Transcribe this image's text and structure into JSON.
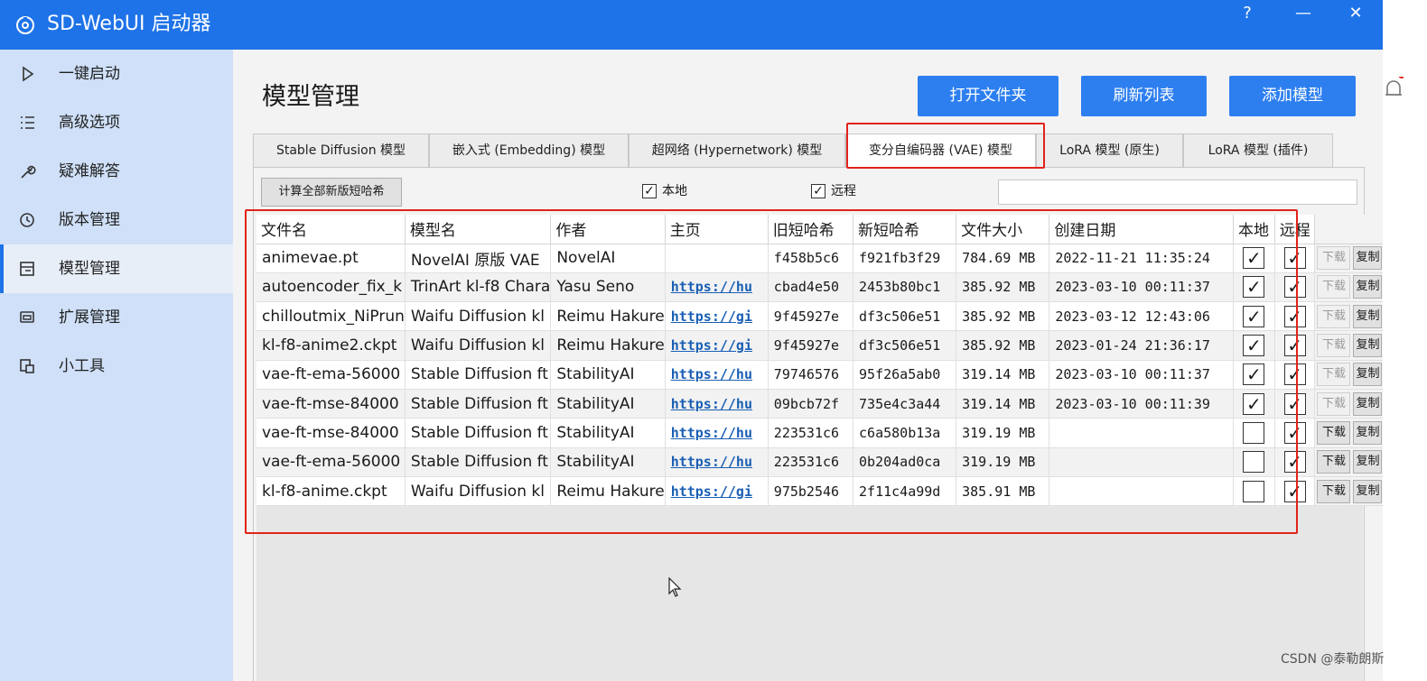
{
  "app": {
    "title": "SD-WebUI 启动器",
    "help_label": "?",
    "minimize_label": "—",
    "close_label": "✕"
  },
  "sidebar": {
    "items": [
      {
        "label": "一键启动",
        "icon": "play-icon"
      },
      {
        "label": "高级选项",
        "icon": "list-icon"
      },
      {
        "label": "疑难解答",
        "icon": "wrench-icon"
      },
      {
        "label": "版本管理",
        "icon": "history-icon"
      },
      {
        "label": "模型管理",
        "icon": "model-icon",
        "active": true
      },
      {
        "label": "扩展管理",
        "icon": "extension-icon"
      },
      {
        "label": "小工具",
        "icon": "tools-icon"
      }
    ]
  },
  "page": {
    "title": "模型管理",
    "buttons": {
      "open_folder": "打开文件夹",
      "refresh": "刷新列表",
      "add_model": "添加模型"
    },
    "tabs": [
      "Stable Diffusion 模型",
      "嵌入式 (Embedding) 模型",
      "超网络 (Hypernetwork) 模型",
      "变分自编码器 (VAE) 模型",
      "LoRA 模型 (原生)",
      "LoRA 模型 (插件)"
    ],
    "active_tab": 3,
    "calc_button": "计算全部新版短哈希",
    "filter_local": {
      "label": "本地",
      "checked": true
    },
    "filter_remote": {
      "label": "远程",
      "checked": true
    },
    "search_value": ""
  },
  "table": {
    "headers": [
      "文件名",
      "模型名",
      "作者",
      "主页",
      "旧短哈希",
      "新短哈希",
      "文件大小",
      "创建日期",
      "本地",
      "远程"
    ],
    "download_label": "下载",
    "copy_label": "复制",
    "check_mark": "✓",
    "rows": [
      {
        "file": "animevae.pt",
        "model": "NovelAI 原版 VAE",
        "author": "NovelAI",
        "home": "",
        "old_hash": "f458b5c6",
        "new_hash": "f921fb3f29",
        "size": "784.69 MB",
        "date": "2022-11-21 11:35:24",
        "local": true,
        "remote": true
      },
      {
        "file": "autoencoder_fix_k",
        "model": "TrinArt kl-f8 Chara",
        "author": "Yasu Seno",
        "home": "https://hu",
        "old_hash": "cbad4e50",
        "new_hash": "2453b80bc1",
        "size": "385.92 MB",
        "date": "2023-03-10 00:11:37",
        "local": true,
        "remote": true
      },
      {
        "file": "chilloutmix_NiPrun",
        "model": "Waifu Diffusion kl",
        "author": "Reimu Hakure",
        "home": "https://gi",
        "old_hash": "9f45927e",
        "new_hash": "df3c506e51",
        "size": "385.92 MB",
        "date": "2023-03-12 12:43:06",
        "local": true,
        "remote": true
      },
      {
        "file": "kl-f8-anime2.ckpt",
        "model": "Waifu Diffusion kl",
        "author": "Reimu Hakure",
        "home": "https://gi",
        "old_hash": "9f45927e",
        "new_hash": "df3c506e51",
        "size": "385.92 MB",
        "date": "2023-01-24 21:36:17",
        "local": true,
        "remote": true
      },
      {
        "file": "vae-ft-ema-56000",
        "model": "Stable Diffusion ft",
        "author": "StabilityAI",
        "home": "https://hu",
        "old_hash": "79746576",
        "new_hash": "95f26a5ab0",
        "size": "319.14 MB",
        "date": "2023-03-10 00:11:37",
        "local": true,
        "remote": true
      },
      {
        "file": "vae-ft-mse-84000",
        "model": "Stable Diffusion ft",
        "author": "StabilityAI",
        "home": "https://hu",
        "old_hash": "09bcb72f",
        "new_hash": "735e4c3a44",
        "size": "319.14 MB",
        "date": "2023-03-10 00:11:39",
        "local": true,
        "remote": true
      },
      {
        "file": "vae-ft-mse-84000",
        "model": "Stable Diffusion ft",
        "author": "StabilityAI",
        "home": "https://hu",
        "old_hash": "223531c6",
        "new_hash": "c6a580b13a",
        "size": "319.19 MB",
        "date": "",
        "local": false,
        "remote": true
      },
      {
        "file": "vae-ft-ema-56000",
        "model": "Stable Diffusion ft",
        "author": "StabilityAI",
        "home": "https://hu",
        "old_hash": "223531c6",
        "new_hash": "0b204ad0ca",
        "size": "319.19 MB",
        "date": "",
        "local": false,
        "remote": true
      },
      {
        "file": "kl-f8-anime.ckpt",
        "model": "Waifu Diffusion kl",
        "author": "Reimu Hakure",
        "home": "https://gi",
        "old_hash": "975b2546",
        "new_hash": "2f11c4a99d",
        "size": "385.91 MB",
        "date": "",
        "local": false,
        "remote": true
      }
    ]
  },
  "watermark": "CSDN @泰勒朗斯",
  "colors": {
    "accent": "#1e73e8",
    "button": "#2d7ff0",
    "highlight_box": "#e2231a",
    "sidebar_bg": "#cfe0f8"
  }
}
